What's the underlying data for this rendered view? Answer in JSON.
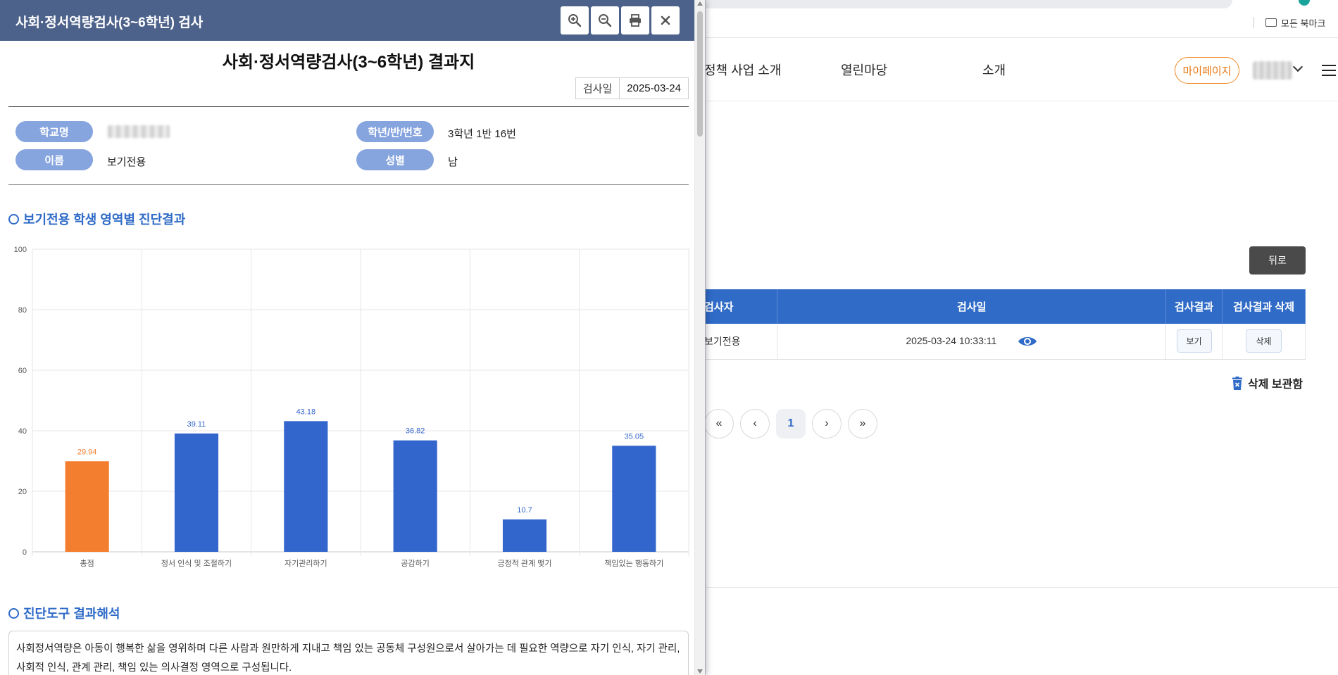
{
  "background": {
    "bookmarks_label": "모든 북마크",
    "nav": {
      "items": [
        "정책 사업 소개",
        "열린마당",
        "소개"
      ],
      "mypage_label": "마이페이지"
    },
    "back_label": "뒤로",
    "table": {
      "headers": [
        "검사자",
        "검사일",
        "검사결과",
        "검사결과 삭제"
      ],
      "rows": [
        {
          "tester": "보기전용",
          "date": "2025-03-24 10:33:11",
          "view_label": "보기",
          "delete_label": "삭제"
        }
      ]
    },
    "trash_label": "삭제 보관함",
    "pagination": {
      "first": "«",
      "prev": "‹",
      "current": "1",
      "next": "›",
      "last": "»"
    }
  },
  "popup": {
    "window_title": "사회·정서역량검사(3~6학년) 검사",
    "tools": [
      "zoom-in-icon",
      "zoom-out-icon",
      "print-icon",
      "close-icon"
    ],
    "doc_title": "사회·정서역량검사(3~6학년) 결과지",
    "exam_date_label": "검사일",
    "exam_date": "2025-03-24",
    "info": {
      "school_label": "학교명",
      "grade_label": "학년/반/번호",
      "grade_value": "3학년 1반 16번",
      "name_label": "이름",
      "name_value": "보기전용",
      "gender_label": "성별",
      "gender_value": "남"
    },
    "section1_title": "보기전용 학생 영역별 진단결과",
    "section2_title": "진단도구 결과해석",
    "interpretation_text": "사회정서역량은 아동이 행복한 삶을 영위하며 다른 사람과 원만하게 지내고 책임 있는 공동체 구성원으로서 살아가는 데 필요한 역량으로 자기 인식, 자기 관리, 사회적 인식, 관계 관리, 책임 있는 의사결정 영역으로 구성됩니다."
  },
  "colors": {
    "header_bg": "#4d628b",
    "accent_blue": "#2f6bc7",
    "bar_blue": "#3366cc",
    "bar_orange": "#f47e30",
    "pill_blue": "#86a4de",
    "mypage_orange": "#e87711"
  },
  "chart_data": {
    "type": "bar",
    "categories": [
      "총점",
      "정서 인식 및 조절하기",
      "자기관리하기",
      "공감하기",
      "긍정적 관계 맺기",
      "책임있는 행동하기"
    ],
    "values": [
      29.94,
      39.11,
      43.18,
      36.82,
      10.7,
      35.05
    ],
    "labels": [
      "29.94",
      "39.11",
      "43.18",
      "36.82",
      "10.7",
      "35.05"
    ],
    "highlight_index": 0,
    "ylim": [
      0,
      100
    ],
    "yticks": [
      0,
      20,
      40,
      60,
      80,
      100
    ],
    "grid": true,
    "title": "",
    "xlabel": "",
    "ylabel": ""
  }
}
